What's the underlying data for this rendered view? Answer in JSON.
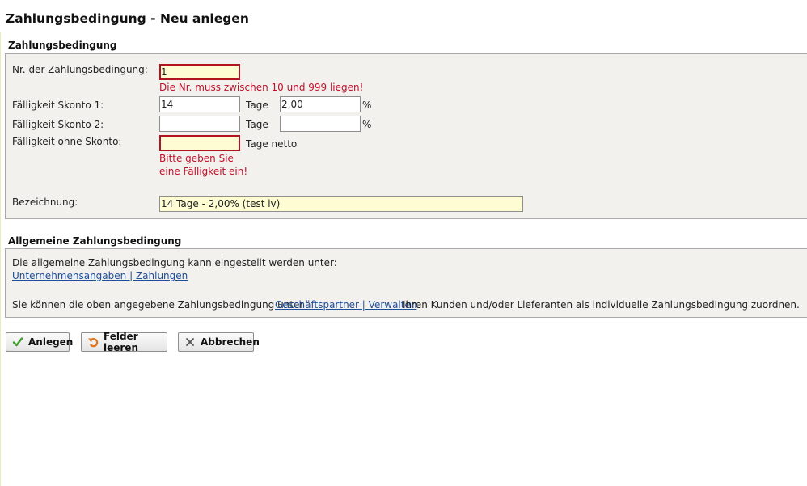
{
  "page": {
    "title": "Zahlungsbedingung - Neu anlegen"
  },
  "section1": {
    "title": "Zahlungsbedingung",
    "nr": {
      "label": "Nr. der Zahlungsbedingung:",
      "value": "1",
      "error": "Die Nr. muss zwischen 10 und 999 liegen!"
    },
    "skonto1": {
      "label": "Fälligkeit Skonto 1:",
      "days_value": "14",
      "days_unit": "Tage",
      "percent_value": "2,00",
      "percent_unit": "%"
    },
    "skonto2": {
      "label": "Fälligkeit Skonto 2:",
      "days_value": "",
      "days_unit": "Tage",
      "percent_value": "",
      "percent_unit": "%"
    },
    "ohne": {
      "label": "Fälligkeit ohne Skonto:",
      "value": "",
      "unit": "Tage netto",
      "error_line1": "Bitte geben Sie",
      "error_line2": "eine Fälligkeit ein!"
    },
    "bezeichnung": {
      "label": "Bezeichnung:",
      "value": "14 Tage - 2,00% (test iv)"
    }
  },
  "section2": {
    "title": "Allgemeine Zahlungsbedingung",
    "text1": "Die allgemeine Zahlungsbedingung kann eingestellt werden unter:",
    "link1": "Unternehmensangaben | Zahlungen",
    "text2_prefix": "Sie können die oben angegebene Zahlungsbedingung unter",
    "link2": "Geschäftspartner | Verwalten",
    "text2_suffix": "Ihren Kunden und/oder Lieferanten als individuelle Zahlungsbedingung zuordnen."
  },
  "buttons": {
    "anlegen": "Anlegen",
    "felder_leeren": "Felder leeren",
    "abbrechen": "Abbrechen"
  },
  "colors": {
    "error": "#c0102a",
    "error_border": "#b0141e",
    "highlight_field": "#fefcd2",
    "link": "#1d4f9a",
    "panel_bg": "#f2f1ee"
  }
}
